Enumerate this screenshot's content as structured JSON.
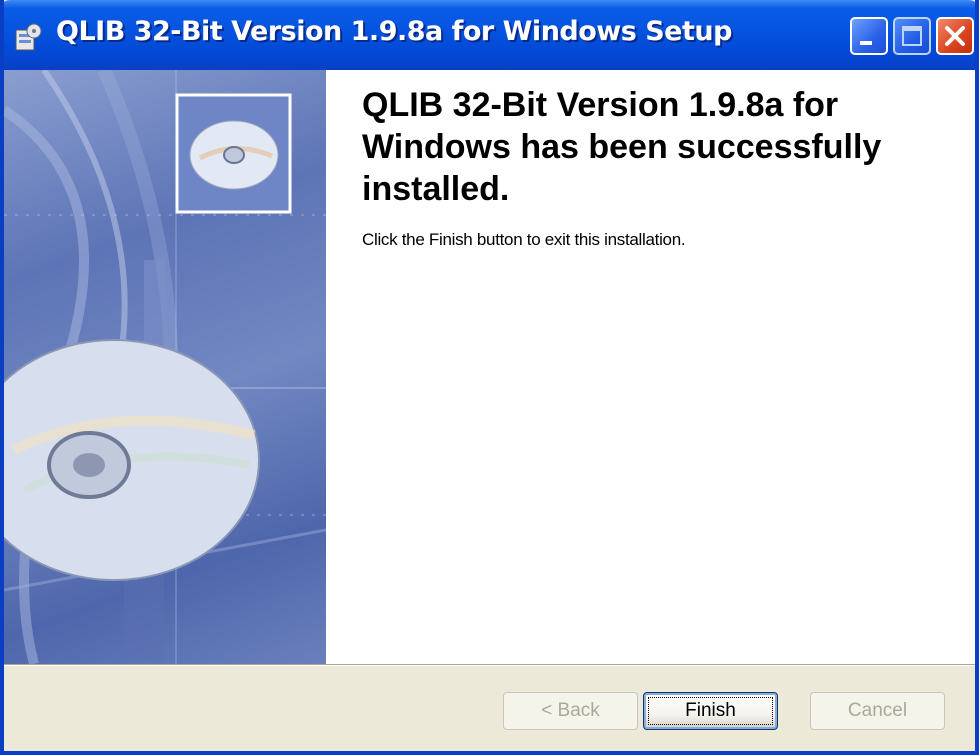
{
  "window": {
    "title": "QLIB 32-Bit Version 1.9.8a for Windows Setup",
    "title_bar_color": "#0553e0",
    "controls": {
      "minimize_icon": "minimize-icon",
      "maximize_icon": "maximize-icon",
      "close_icon": "close-icon"
    }
  },
  "main": {
    "heading": "QLIB 32-Bit Version 1.9.8a for Windows has been successfully installed.",
    "description": "Click the Finish button to exit this installation."
  },
  "banner": {
    "image": "installer-cd-banner"
  },
  "buttons": {
    "back": {
      "label": "< Back",
      "enabled": false
    },
    "finish": {
      "label": "Finish",
      "enabled": true,
      "focused": true
    },
    "cancel": {
      "label": "Cancel",
      "enabled": false
    }
  }
}
